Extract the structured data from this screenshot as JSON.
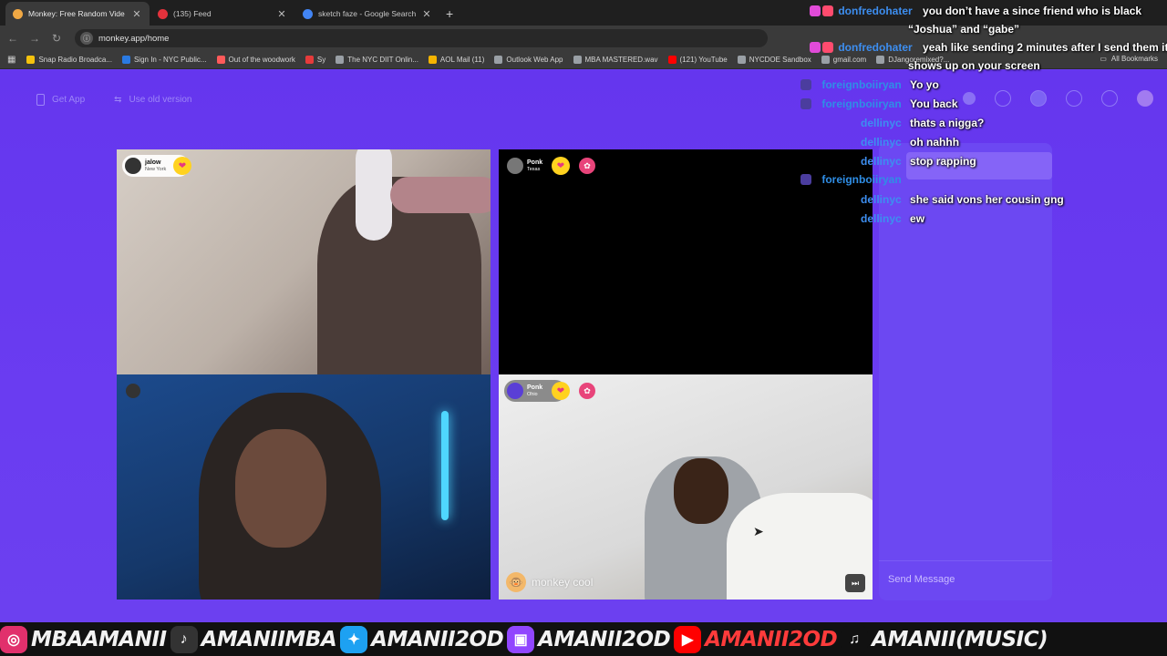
{
  "browser": {
    "tabs": [
      {
        "title": "Monkey: Free Random Vide",
        "color": "#f0a844",
        "active": true
      },
      {
        "title": "(135) Feed",
        "color": "#e3323c",
        "active": false
      },
      {
        "title": "sketch faze - Google Search",
        "color": "#4285f4",
        "active": false
      }
    ],
    "url": "monkey.app/home",
    "bookmarks": [
      {
        "label": "Snap Radio Broadca...",
        "color": "#f4c20d"
      },
      {
        "label": "Sign In - NYC Public...",
        "color": "#2a7ae2"
      },
      {
        "label": "Out of the woodwork",
        "color": "#ff5a5a"
      },
      {
        "label": "Sy",
        "color": "#e63b3b"
      },
      {
        "label": "The NYC DIIT Onlin...",
        "color": "#9aa0a6"
      },
      {
        "label": "AOL Mail (11)",
        "color": "#f5b400"
      },
      {
        "label": "Outlook Web App",
        "color": "#9aa0a6"
      },
      {
        "label": "MBA MASTERED.wav",
        "color": "#9aa0a6"
      },
      {
        "label": "(121) YouTube",
        "color": "#ff0000"
      },
      {
        "label": "NYCDOE Sandbox",
        "color": "#9aa0a6"
      },
      {
        "label": "gmail.com",
        "color": "#9aa0a6"
      },
      {
        "label": "DJangoremixed?...",
        "color": "#9aa0a6"
      }
    ],
    "all_bookmarks": "All Bookmarks"
  },
  "page": {
    "get_app": "Get App",
    "use_old_version": "Use old version",
    "videos": [
      {
        "name": "jalow",
        "location": "New York"
      },
      {
        "name": "Ponk",
        "location": "Texas"
      },
      {
        "name": "",
        "location": ""
      },
      {
        "name": "Ponk",
        "location": "Ohio"
      }
    ],
    "monkey_cool": "monkey cool",
    "send_message": "Send Message"
  },
  "stream_chat": [
    {
      "user": "donfredohater",
      "text": "you don’t have a since friend who is black",
      "color": "#3d8ef0"
    },
    {
      "user": "",
      "text": "“Joshua” and “gabe”",
      "color": "#3d8ef0"
    },
    {
      "user": "donfredohater",
      "text": "yeah like sending 2 minutes after I send them it",
      "color": "#3d8ef0"
    },
    {
      "user": "",
      "text": "shows up on your screen",
      "color": "#3d8ef0"
    },
    {
      "user": "foreignboiiryan",
      "text": "Yo yo",
      "color": "#2f8ee6"
    },
    {
      "user": "foreignboiiryan",
      "text": "You back",
      "color": "#2f8ee6"
    },
    {
      "user": "dellinyc",
      "text": "thats a nigga?",
      "color": "#3d8ef0"
    },
    {
      "user": "dellinyc",
      "text": "oh nahhh",
      "color": "#3d8ef0"
    },
    {
      "user": "dellinyc",
      "text": "stop rapping",
      "color": "#3d8ef0"
    },
    {
      "user": "foreignboiiryan",
      "text": "",
      "color": "#2f8ee6"
    },
    {
      "user": "dellinyc",
      "text": "she said vons her cousin gng",
      "color": "#3d8ef0"
    },
    {
      "user": "dellinyc",
      "text": "ew",
      "color": "#3d8ef0"
    }
  ],
  "socials": [
    {
      "platform": "instagram-icon",
      "handle": "MBAAMANII",
      "color": "#e1306c"
    },
    {
      "platform": "tiktok-icon",
      "handle": "AMANIIMBA",
      "color": "#222222"
    },
    {
      "platform": "twitter-icon",
      "handle": "AMANII2OD",
      "color": "#1da1f2"
    },
    {
      "platform": "twitch-icon",
      "handle": "AMANII2OD",
      "color": "#9146ff"
    },
    {
      "platform": "youtube-icon",
      "handle": "AMANII2OD",
      "color": "#ff0000"
    },
    {
      "platform": "music-icon",
      "handle": "AMANII(MUSIC)",
      "color": "#ffffff"
    }
  ]
}
